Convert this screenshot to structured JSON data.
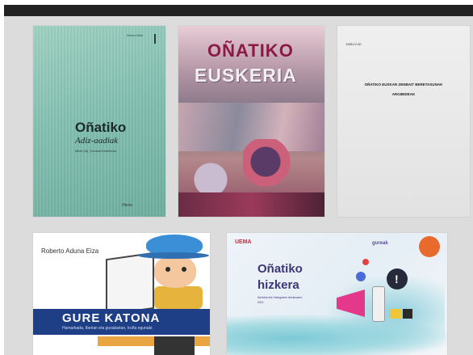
{
  "cards": [
    {
      "title": "Oñatiko",
      "subtitle": "Adiz-aadiak",
      "authors": "Mikel Zaj, Gontzal Etxeberria",
      "top_note": "Kultura Saila",
      "publisher_logo": "Hasia"
    },
    {
      "title": "OÑATIKO",
      "subtitle": "EUSKERIA"
    },
    {
      "date": "1985-IV-30",
      "line1": "OÑATIKO EUSKAR ZENBAIT BERETASUNAK",
      "line2": "ARGIBIDEAK"
    },
    {
      "author": "Roberto Aduna Eiza",
      "title": "GURE KATONA",
      "subtitle": "Hamarkada, Iberian eta gozakarian, Iruña egunabi"
    },
    {
      "brand": "UEMA",
      "partner": "gureak",
      "title_line1": "Oñatiko",
      "title_line2": "hizkera",
      "desc_line1": "Ikerketa eta Hiztegiaren Ikerlanaren",
      "desc_line2": "2021"
    }
  ]
}
